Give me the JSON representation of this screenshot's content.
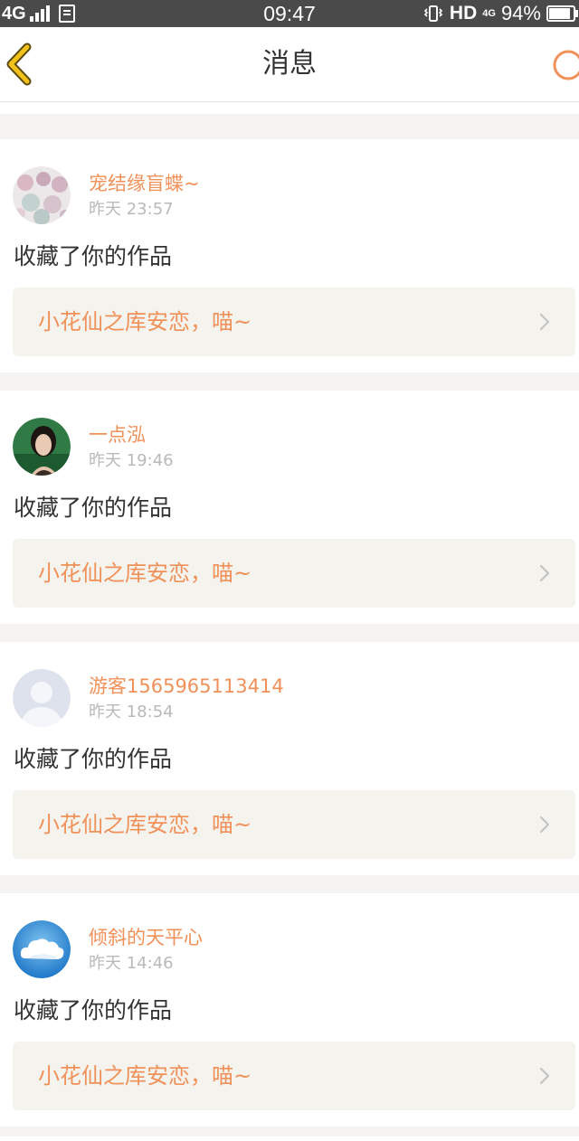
{
  "status_bar": {
    "network": "4G",
    "time": "09:47",
    "hd": "HD",
    "network_small": "4G",
    "battery": "94%",
    "battery_level": 0.94
  },
  "header": {
    "title": "消息",
    "back_icon": "chevron-left-icon",
    "right_icon": "circle-icon"
  },
  "colors": {
    "accent": "#f0915a",
    "back_icon": "#f2c21b",
    "text_primary": "#333333",
    "text_secondary": "#b9b9b9",
    "card_inner_bg": "#f4f3ee"
  },
  "messages": [
    {
      "username": "宠结缘盲蝶~",
      "time": "昨天 23:57",
      "action": "收藏了你的作品",
      "work_title": "小花仙之库安恋，喵~"
    },
    {
      "username": "一点泓",
      "time": "昨天 19:46",
      "action": "收藏了你的作品",
      "work_title": "小花仙之库安恋，喵~"
    },
    {
      "username": "游客1565965113414",
      "time": "昨天 18:54",
      "action": "收藏了你的作品",
      "work_title": "小花仙之库安恋，喵~"
    },
    {
      "username": "倾斜的天平心",
      "time": "昨天 14:46",
      "action": "收藏了你的作品",
      "work_title": "小花仙之库安恋，喵~"
    }
  ]
}
